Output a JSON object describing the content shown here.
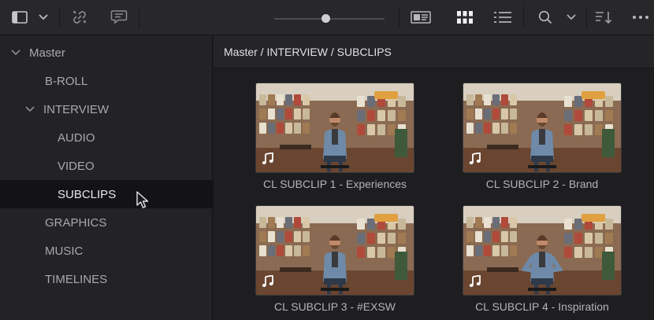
{
  "toolbar": {
    "icons": [
      "panel-layout-icon",
      "chevron-down-icon",
      "unlink-icon",
      "caption-icon",
      "zoom-slider",
      "metadata-view-icon",
      "thumbnail-view-icon",
      "list-view-icon",
      "search-icon",
      "chevron-down-icon",
      "sort-icon",
      "more-options-icon"
    ],
    "active_view": "thumbnail"
  },
  "sidebar": {
    "items": [
      {
        "label": "Master",
        "level": 0,
        "expanded": true
      },
      {
        "label": "B-ROLL",
        "level": 1
      },
      {
        "label": "INTERVIEW",
        "level": 1,
        "expanded": true
      },
      {
        "label": "AUDIO",
        "level": 2
      },
      {
        "label": "VIDEO",
        "level": 2
      },
      {
        "label": "SUBCLIPS",
        "level": 2,
        "selected": true
      },
      {
        "label": "GRAPHICS",
        "level": 1
      },
      {
        "label": "MUSIC",
        "level": 1
      },
      {
        "label": "TIMELINES",
        "level": 1
      }
    ]
  },
  "breadcrumb": "Master / INTERVIEW / SUBCLIPS",
  "clips": [
    {
      "name": "CL SUBCLIP 1 - Experiences",
      "badge_icon": "music-note-icon"
    },
    {
      "name": "CL SUBCLIP 2 - Brand",
      "badge_icon": "music-note-icon"
    },
    {
      "name": "CL SUBCLIP 3 - #EXSW",
      "badge_icon": "music-note-icon"
    },
    {
      "name": "CL SUBCLIP 4 - Inspiration",
      "badge_icon": "music-note-icon"
    }
  ],
  "colors": {
    "toolbar_bg": "#28282b",
    "sidebar_bg": "#232326",
    "selected_row": "#131315",
    "text": "#a9a9ad"
  }
}
